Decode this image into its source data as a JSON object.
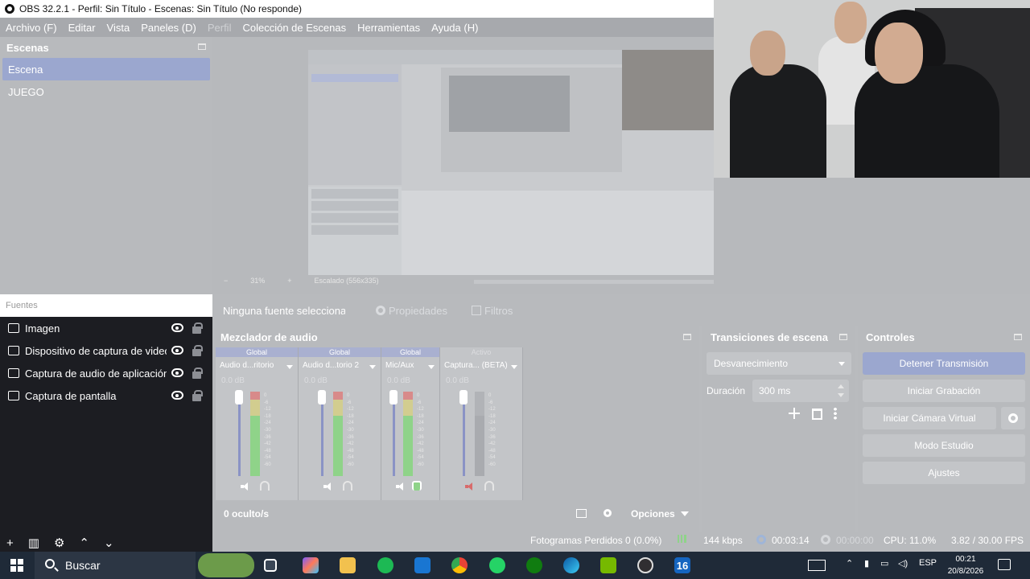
{
  "window": {
    "title": "OBS 32.2.1 - Perfil: Sin Título - Escenas: Sin Título (No responde)"
  },
  "menu": [
    "Archivo (F)",
    "Editar",
    "Vista",
    "Paneles (D)",
    "Perfil",
    "Colección de Escenas",
    "Herramientas",
    "Ayuda (H)"
  ],
  "scenes": {
    "title": "Escenas",
    "items": [
      "Escena",
      "JUEGO"
    ],
    "active_index": 0
  },
  "sources": {
    "title": "Fuentes",
    "items": [
      {
        "label": "Imagen",
        "icon": "image-icon"
      },
      {
        "label": "Dispositivo de captura de video",
        "icon": "camera-icon"
      },
      {
        "label": "Captura de audio de aplicación (BETA)",
        "icon": "audio-capture-icon"
      },
      {
        "label": "Captura de pantalla",
        "icon": "monitor-icon"
      }
    ]
  },
  "preview": {
    "zoom_minus": "−",
    "zoom_value": "31%",
    "zoom_plus": "+",
    "scale_label": "Escalado (556x335)"
  },
  "source_toolbar": {
    "no_source": "Ninguna fuente seleccionada",
    "properties": "Propiedades",
    "filters": "Filtros"
  },
  "mixer": {
    "title": "Mezclador de audio",
    "channels": [
      {
        "tag": "Global",
        "name": "Audio d...ritorio",
        "db": "0.0 dB",
        "muted": false,
        "monitor": false
      },
      {
        "tag": "Global",
        "name": "Audio d...torio 2",
        "db": "0.0 dB",
        "muted": false,
        "monitor": false
      },
      {
        "tag": "Global",
        "name": "Mic/Aux",
        "db": "0.0 dB",
        "muted": false,
        "monitor": true
      },
      {
        "tag": "Activo",
        "name": "Captura... (BETA)",
        "db": "0.0 dB",
        "muted": true,
        "monitor": false
      }
    ],
    "scale": [
      "0",
      "-6",
      "-12",
      "-18",
      "-24",
      "-30",
      "-36",
      "-42",
      "-48",
      "-54",
      "-60"
    ],
    "hidden": "0 oculto/s",
    "options": "Opciones"
  },
  "transitions": {
    "title": "Transiciones de escena",
    "selected": "Desvanecimiento",
    "duration_label": "Duración",
    "duration_value": "300 ms"
  },
  "controls": {
    "title": "Controles",
    "stop_stream": "Detener Transmisión",
    "start_record": "Iniciar Grabación",
    "virtual_cam": "Iniciar Cámara Virtual",
    "studio_mode": "Modo Estudio",
    "settings": "Ajustes"
  },
  "status": {
    "dropped": "Fotogramas Perdidos 0 (0.0%)",
    "bitrate": "144 kbps",
    "stream_time": "00:03:14",
    "rec_time": "00:00:00",
    "cpu": "CPU: 11.0%",
    "fps": "3.82 / 30.00 FPS"
  },
  "taskbar": {
    "search": "Buscar",
    "lang": "ESP",
    "time": "00:21",
    "date": "20/8/2026",
    "badge": "16"
  },
  "colors": {
    "accent": "#9ba7cf",
    "meter_green": "#8fd389",
    "panel": "#b8babd",
    "sources_bg": "#1c1d22"
  }
}
